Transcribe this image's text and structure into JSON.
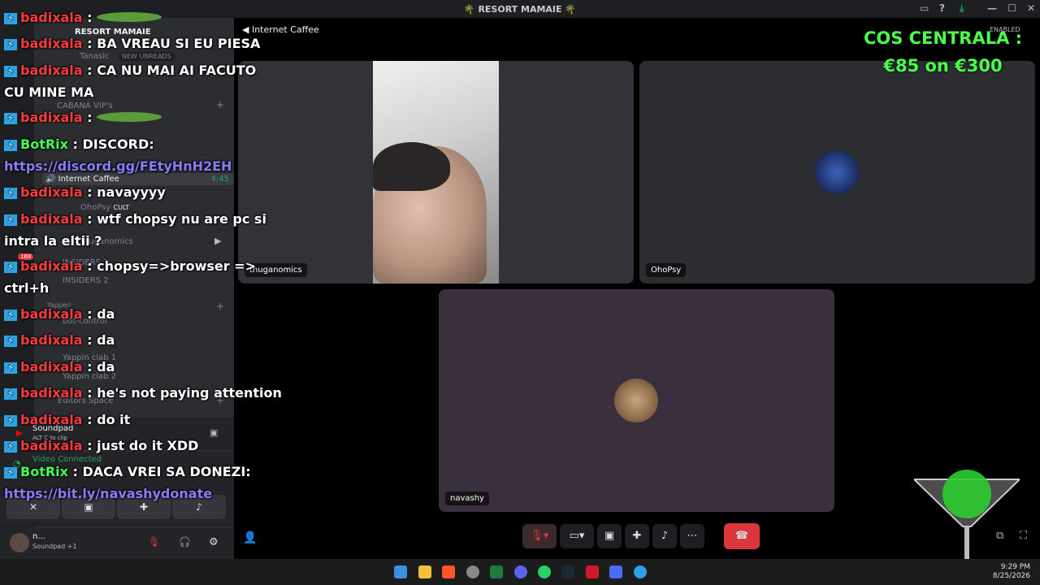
{
  "window": {
    "title": "🌴 RESORT MAMAIE 🌴"
  },
  "server": {
    "name": "RESORT MAMAIE",
    "new_unreads": "NEW UNREADS"
  },
  "sidebar": {
    "channels": [
      {
        "label": "Tanasic"
      },
      {
        "label": "CABANA VIP's"
      },
      {
        "label": "Internet Caffee",
        "time": "4:45",
        "active": true
      },
      {
        "label": "OhoPsy",
        "tag": "CULT"
      },
      {
        "label": "thuganomics"
      },
      {
        "label": "INSIDERS 1"
      },
      {
        "label": "INSIDERS 2"
      },
      {
        "label": "Yapperi"
      },
      {
        "label": "bot-control"
      },
      {
        "label": "Yappin clab",
        "count": "1"
      },
      {
        "label": "Yappin clab",
        "count": "2"
      },
      {
        "label": "Editors Space"
      }
    ],
    "unread_badge": "169"
  },
  "soundpad": {
    "title": "Soundpad",
    "hint_key": "ALT",
    "hint_key2": "C",
    "hint_text": "to clip"
  },
  "voice_panel": {
    "status": "Video Connected"
  },
  "user_panel": {
    "name": "n...",
    "status": "Soundpad +1"
  },
  "call": {
    "channel_name": "Internet Caffee",
    "participants": [
      {
        "name": "thuganomics"
      },
      {
        "name": "OhoPsy"
      },
      {
        "name": "navashy"
      }
    ],
    "enabled_label": "ENABLED"
  },
  "overlay": {
    "donate_line1": "COS CENTRALA :",
    "donate_line2": "€85 on €300",
    "chat": [
      {
        "user": "badixala",
        "text": ":",
        "kind": "user"
      },
      {
        "user": "badixala",
        "text": ": BA VREAU SI EU PIESA",
        "kind": "user"
      },
      {
        "user": "badixala",
        "text": ": CA NU MAI AI FACUTO",
        "kind": "user"
      },
      {
        "user": "",
        "text": "CU MINE MA",
        "kind": "cont"
      },
      {
        "user": "badixala",
        "text": ":",
        "kind": "user"
      },
      {
        "user": "BotRix",
        "text": ": DISCORD:",
        "kind": "bot"
      },
      {
        "user": "",
        "text": "https://discord.gg/FEtyHnH2EH",
        "kind": "link"
      },
      {
        "user": "badixala",
        "text": ": navayyyy",
        "kind": "user"
      },
      {
        "user": "badixala",
        "text": ": wtf chopsy nu are pc si",
        "kind": "user"
      },
      {
        "user": "",
        "text": "intra la eltii ?",
        "kind": "cont"
      },
      {
        "user": "badixala",
        "text": ": chopsy=>browser =>",
        "kind": "user"
      },
      {
        "user": "",
        "text": "ctrl+h",
        "kind": "cont"
      },
      {
        "user": "badixala",
        "text": ": da",
        "kind": "user"
      },
      {
        "user": "badixala",
        "text": ": da",
        "kind": "user"
      },
      {
        "user": "badixala",
        "text": ": da",
        "kind": "user"
      },
      {
        "user": "badixala",
        "text": ": he's not paying attention",
        "kind": "user"
      },
      {
        "user": "badixala",
        "text": ": do it",
        "kind": "user"
      },
      {
        "user": "badixala",
        "text": ": just do it XDD",
        "kind": "user"
      },
      {
        "user": "BotRix",
        "text": ": DACA VREI SA DONEZI:",
        "kind": "bot"
      },
      {
        "user": "",
        "text": "https://bit.ly/navashydonate",
        "kind": "link"
      }
    ]
  },
  "taskbar": {
    "time": "9:29 PM",
    "date": "8/25/2026"
  },
  "colors": {
    "accent_green": "#4dff4d",
    "end_call": "#da373c",
    "user_red": "#ff3b3b"
  }
}
